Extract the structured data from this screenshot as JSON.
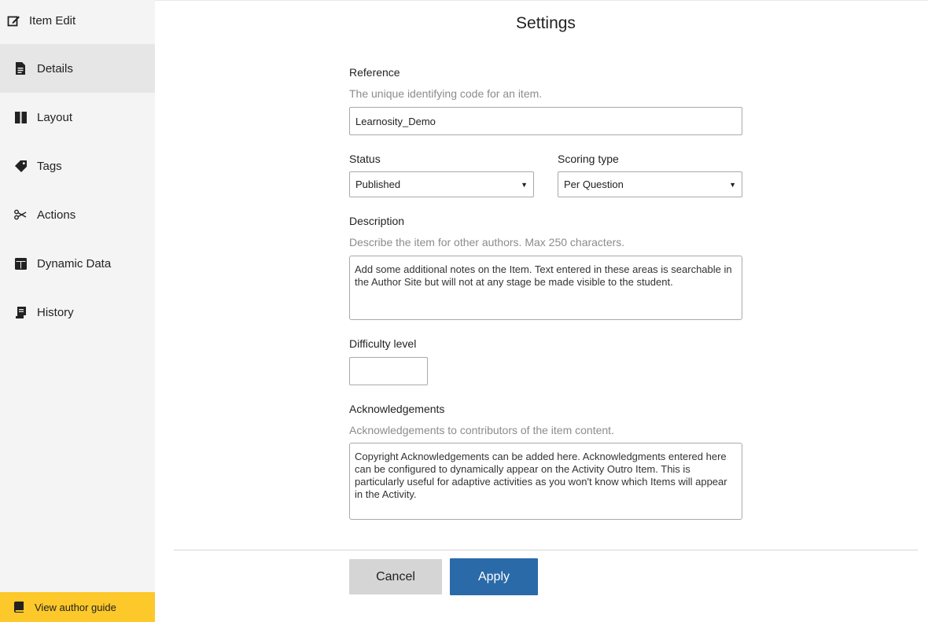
{
  "sidebar": {
    "header": {
      "label": "Item Edit",
      "icon": "edit-icon"
    },
    "items": [
      {
        "label": "Details",
        "icon": "document-icon",
        "active": true
      },
      {
        "label": "Layout",
        "icon": "columns-icon",
        "active": false
      },
      {
        "label": "Tags",
        "icon": "tag-icon",
        "active": false
      },
      {
        "label": "Actions",
        "icon": "scissors-icon",
        "active": false
      },
      {
        "label": "Dynamic Data",
        "icon": "table-icon",
        "active": false
      },
      {
        "label": "History",
        "icon": "scroll-icon",
        "active": false
      }
    ],
    "guide": {
      "label": "View author guide",
      "icon": "book-icon",
      "color": "#fcc82a"
    }
  },
  "main": {
    "title": "Settings",
    "reference": {
      "label": "Reference",
      "hint": "The unique identifying code for an item.",
      "value": "Learnosity_Demo"
    },
    "status": {
      "label": "Status",
      "value": "Published"
    },
    "scoring": {
      "label": "Scoring type",
      "value": "Per Question"
    },
    "description": {
      "label": "Description",
      "hint": "Describe the item for other authors. Max 250 characters.",
      "value": "Add some additional notes on the Item. Text entered in these areas is searchable in the Author Site but will not at any stage be made visible to the student."
    },
    "difficulty": {
      "label": "Difficulty level",
      "value": ""
    },
    "acknowledgements": {
      "label": "Acknowledgements",
      "hint": "Acknowledgements to contributors of the item content.",
      "value": "Copyright Acknowledgements can be added here. Acknowledgments entered here can be configured to dynamically appear on the Activity Outro Item. This is particularly useful for adaptive activities as you won't know which Items will appear in the Activity."
    }
  },
  "footer": {
    "cancel_label": "Cancel",
    "apply_label": "Apply",
    "apply_color": "#2a6aa8"
  }
}
